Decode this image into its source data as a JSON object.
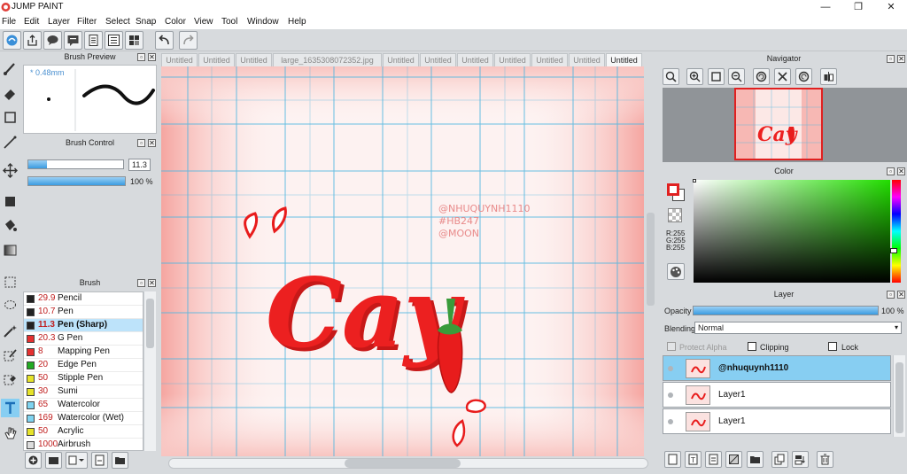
{
  "app": {
    "title": "JUMP PAINT"
  },
  "window_controls": {
    "minimize": "—",
    "maximize": "❐",
    "close": "✕"
  },
  "menu": [
    "File",
    "Edit",
    "Layer",
    "Filter",
    "Select",
    "Snap",
    "Color",
    "View",
    "Tool",
    "Window",
    "Help"
  ],
  "toolbar_icons": [
    "cloud-sync-icon",
    "share-icon",
    "comment-icon",
    "chat-icon",
    "document-icon",
    "settings-list-icon",
    "grid-list-icon",
    "undo-icon",
    "redo-icon"
  ],
  "tools": [
    "brush-icon",
    "eraser-icon",
    "rectangle-icon",
    "pen-line-icon",
    "move-icon",
    "fill-square-icon",
    "bucket-icon",
    "gradient-icon",
    "select-rect-icon",
    "lasso-icon",
    "magic-wand-icon",
    "select-pen-icon",
    "select-eraser-icon",
    "text-icon",
    "hand-icon"
  ],
  "brush_preview": {
    "title": "Brush Preview",
    "size_label": "* 0.48mm"
  },
  "brush_control": {
    "title": "Brush Control",
    "size_value": "11.3",
    "size_fraction": 0.2,
    "opacity_value": "100 %",
    "opacity_fraction": 1.0
  },
  "brush_panel": {
    "title": "Brush",
    "items": [
      {
        "size": "29.9",
        "name": "Pencil",
        "color": "#222222"
      },
      {
        "size": "10.7",
        "name": "Pen",
        "color": "#222222"
      },
      {
        "size": "11.3",
        "name": "Pen (Sharp)",
        "color": "#222222",
        "selected": true
      },
      {
        "size": "20.3",
        "name": "G Pen",
        "color": "#e53030"
      },
      {
        "size": "8",
        "name": "Mapping Pen",
        "color": "#e53030"
      },
      {
        "size": "20",
        "name": "Edge Pen",
        "color": "#22aa22"
      },
      {
        "size": "50",
        "name": "Stipple Pen",
        "color": "#e6e32a"
      },
      {
        "size": "30",
        "name": "Sumi",
        "color": "#e6e32a"
      },
      {
        "size": "65",
        "name": "Watercolor",
        "color": "#7fd3f0"
      },
      {
        "size": "169",
        "name": "Watercolor (Wet)",
        "color": "#7fd3f0"
      },
      {
        "size": "50",
        "name": "Acrylic",
        "color": "#e6e32a"
      },
      {
        "size": "1000",
        "name": "Airbrush",
        "color": "#dddddd"
      }
    ]
  },
  "tabs": [
    "Untitled",
    "Untitled",
    "Untitled",
    "large_1635308072352.jpg",
    "Untitled",
    "Untitled",
    "Untitled",
    "Untitled",
    "Untitled",
    "Untitled",
    "Untitled"
  ],
  "active_tab": 10,
  "artwork": {
    "lettering": "Cay",
    "credits": [
      "@NHUQUYNH1110",
      "#HB247",
      "@MOON"
    ]
  },
  "navigator": {
    "title": "Navigator",
    "icons": [
      "zoom-fit-icon",
      "zoom-in-icon",
      "fullscreen-icon",
      "zoom-out-icon",
      "rotate-left-icon",
      "reset-icon",
      "rotate-right-icon",
      "flip-icon"
    ]
  },
  "color_panel": {
    "title": "Color",
    "r": "R:255",
    "g": "G:255",
    "b": "B:255",
    "fg": "#e02020",
    "bg": "#ffffff"
  },
  "layer_panel": {
    "title": "Layer",
    "opacity_label": "Opacity",
    "opacity_value": "100 %",
    "opacity_fraction": 1.0,
    "blending_label": "Blending",
    "blending_value": "Normal",
    "protect_alpha": "Protect Alpha",
    "clipping": "Clipping",
    "lock": "Lock",
    "layers": [
      {
        "name": "@nhuquynh1110",
        "selected": true
      },
      {
        "name": "Layer1",
        "selected": false
      },
      {
        "name": "Layer1",
        "selected": false
      }
    ]
  }
}
